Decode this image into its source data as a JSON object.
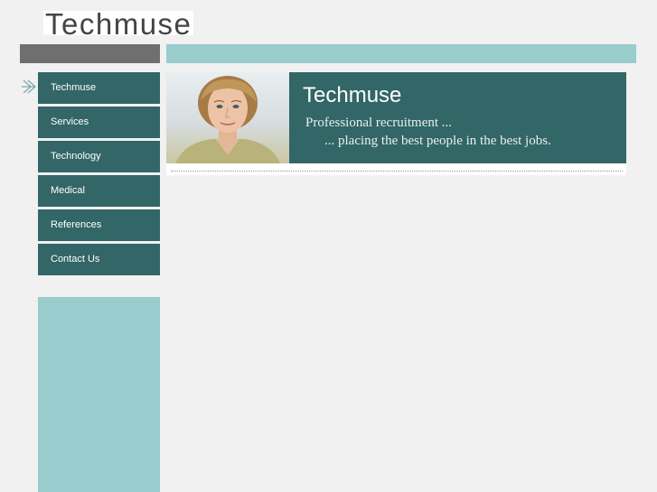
{
  "header": {
    "logo_text": "Techmuse"
  },
  "nav": {
    "items": [
      {
        "label": "Techmuse"
      },
      {
        "label": "Services"
      },
      {
        "label": "Technology"
      },
      {
        "label": "Medical"
      },
      {
        "label": "References"
      },
      {
        "label": "Contact Us"
      }
    ],
    "active_icon": "double-chevron-right-icon"
  },
  "banner": {
    "title": "Techmuse",
    "tagline_line1": "Professional recruitment ...",
    "tagline_line2": "... placing the best people in the best jobs.",
    "photo_icon": "portrait-photo"
  },
  "colors": {
    "page_bg": "#f1f1f1",
    "nav_bg": "#336666",
    "accent_teal": "#99cccc",
    "bar_gray": "#6f6f6f"
  }
}
